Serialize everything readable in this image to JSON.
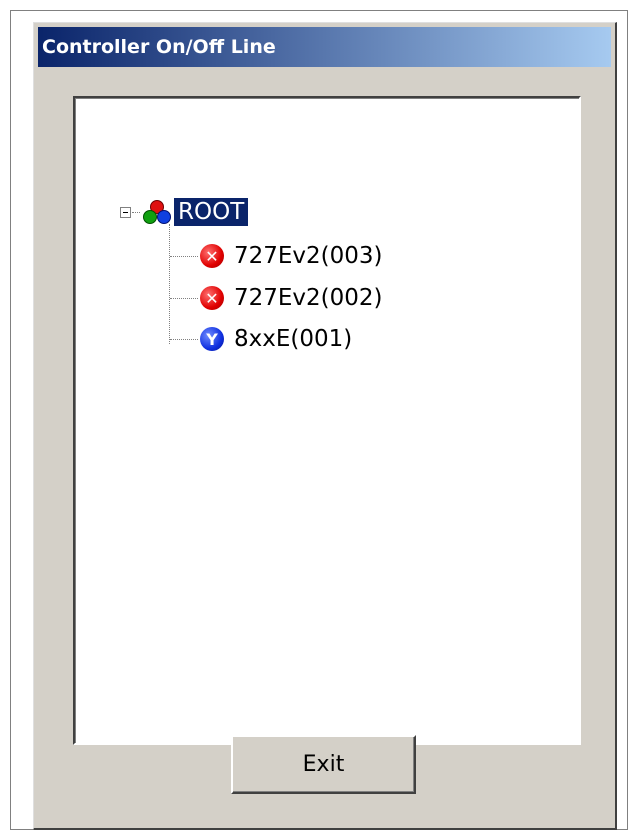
{
  "window": {
    "title": "Controller On/Off Line",
    "title_gradient_start": "#0a246a",
    "title_gradient_end": "#a6caf0"
  },
  "tree": {
    "root": {
      "label": "ROOT",
      "icon": "root-node-icon",
      "expanded": true,
      "selected": true
    },
    "children": [
      {
        "label": "727Ev2(003)",
        "icon": "offline-x-icon",
        "status": "offline"
      },
      {
        "label": "727Ev2(002)",
        "icon": "offline-x-icon",
        "status": "offline"
      },
      {
        "label": "8xxE(001)",
        "icon": "online-y-icon",
        "status": "online"
      }
    ]
  },
  "buttons": {
    "exit_label": "Exit"
  }
}
